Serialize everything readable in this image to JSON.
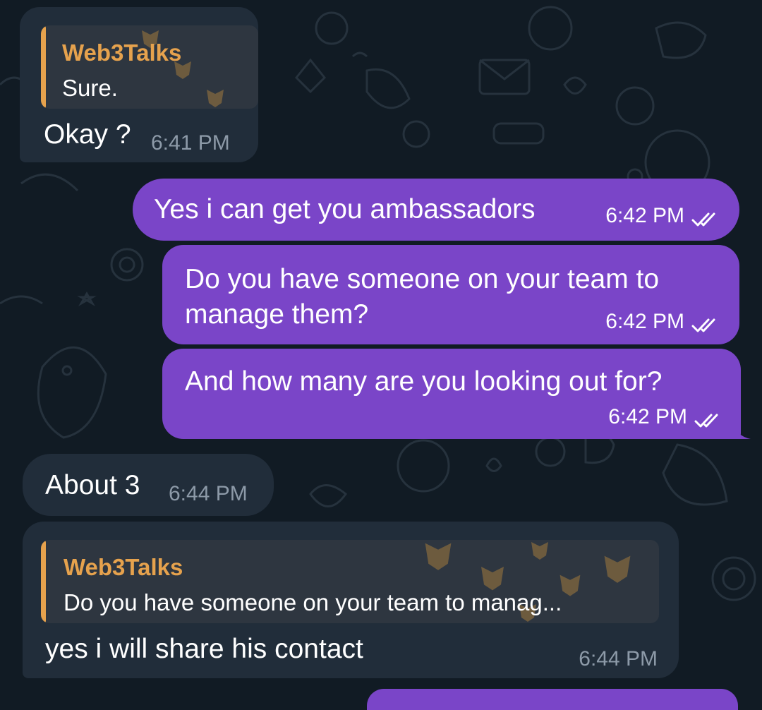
{
  "colors": {
    "background": "#111b24",
    "incoming_bubble": "#212d3a",
    "outgoing_bubble": "#7a45c8",
    "reply_accent": "#e6a24d",
    "incoming_time": "#8d9aa8"
  },
  "messages": [
    {
      "direction": "incoming",
      "reply_to": {
        "author": "Web3Talks",
        "text": "Sure."
      },
      "text": "Okay ?",
      "time": "6:41 PM"
    },
    {
      "direction": "outgoing",
      "text": "Yes i can get you ambassadors",
      "time": "6:42 PM",
      "status_icon": "double-check-icon"
    },
    {
      "direction": "outgoing",
      "text_lines": [
        "Do you have someone on your team to",
        "manage them?"
      ],
      "time": "6:42 PM",
      "status_icon": "double-check-icon"
    },
    {
      "direction": "outgoing",
      "text": "And how many are you looking out for?",
      "time": "6:42 PM",
      "status_icon": "double-check-icon"
    },
    {
      "direction": "incoming",
      "text": "About 3",
      "time": "6:44 PM"
    },
    {
      "direction": "incoming",
      "reply_to": {
        "author": "Web3Talks",
        "text": "Do you have someone on your team to manag..."
      },
      "text": "yes i will share his contact",
      "time": "6:44 PM"
    }
  ]
}
